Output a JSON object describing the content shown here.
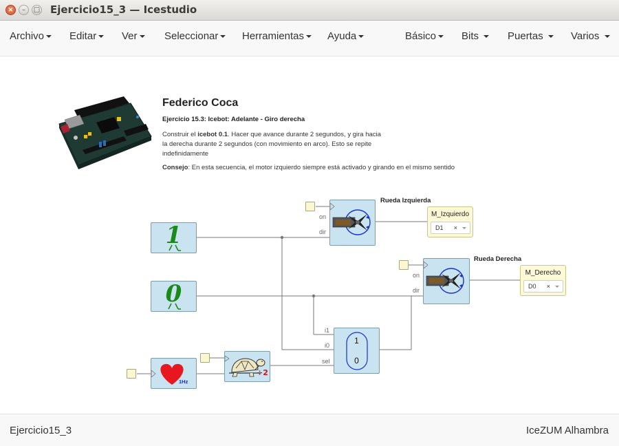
{
  "window": {
    "title": "Ejercicio15_3 — Icestudio"
  },
  "menu": {
    "archivo": "Archivo",
    "editar": "Editar",
    "ver": "Ver",
    "seleccionar": "Seleccionar",
    "herramientas": "Herramientas",
    "ayuda": "Ayuda",
    "basico": "Básico",
    "bits": "Bits",
    "puertas": "Puertas",
    "varios": "Varios"
  },
  "info": {
    "author": "Federico Coca",
    "ex_prefix": "Ejercicio 15.3",
    "ex_rest": ": Icebot: Adelante - Giro derecha",
    "desc_1": "Construir el ",
    "desc_bold": "icebot 0.1",
    "desc_2": ". Hacer que avance durante 2 segundos, y gira hacia la derecha durante 2 segundos (con movimiento en arco). Esto se repite indefinidamente",
    "tip_bold": "Consejo",
    "tip_rest": ": En esta secuencia, el motor izquierdo siempre está activado y girando en el mismo sentido"
  },
  "blocks": {
    "const_one": "1",
    "const_zero": "0",
    "heart_freq": "1Hz",
    "divider_label": "÷2",
    "mux_top": "1",
    "mux_bottom": "0"
  },
  "ports": {
    "on": "on",
    "dir": "dir",
    "i1": "i1",
    "i0": "i0",
    "sel": "sel"
  },
  "servos": {
    "left_title": "Rueda Izquierda",
    "right_title": "Rueda Derecha"
  },
  "outputs": {
    "left": {
      "label": "M_Izquierdo",
      "pin": "D1"
    },
    "right": {
      "label": "M_Derecho",
      "pin": "D0"
    },
    "clear": "×"
  },
  "footer": {
    "project": "Ejercicio15_3",
    "board": "IceZUM Alhambra"
  },
  "colors": {
    "block_fill": "#c9e3f0",
    "wire": "#777777",
    "heart": "#e8161f",
    "const_green": "#1a8a1a"
  }
}
